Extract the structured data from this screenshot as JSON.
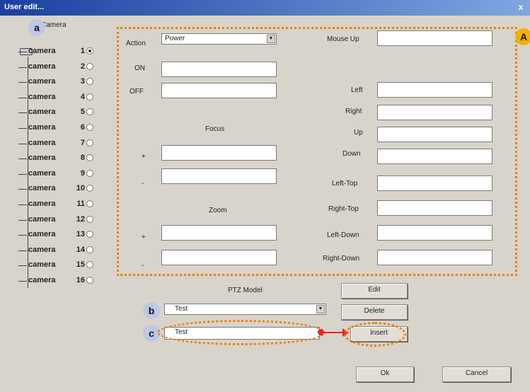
{
  "window": {
    "title": "User edit...",
    "close": "x"
  },
  "badges": {
    "a": "a",
    "A": "A",
    "b": "b",
    "c": "c"
  },
  "tree": {
    "label": "Camera",
    "items": [
      {
        "label": "camera",
        "num": "1",
        "selected": true
      },
      {
        "label": "camera",
        "num": "2"
      },
      {
        "label": "camera",
        "num": "3"
      },
      {
        "label": "camera",
        "num": "4"
      },
      {
        "label": "camera",
        "num": "5"
      },
      {
        "label": "camera",
        "num": "6"
      },
      {
        "label": "camera",
        "num": "7"
      },
      {
        "label": "camera",
        "num": "8"
      },
      {
        "label": "camera",
        "num": "9"
      },
      {
        "label": "camera",
        "num": "10"
      },
      {
        "label": "camera",
        "num": "11"
      },
      {
        "label": "camera",
        "num": "12"
      },
      {
        "label": "camera",
        "num": "13"
      },
      {
        "label": "camera",
        "num": "14"
      },
      {
        "label": "camera",
        "num": "15"
      },
      {
        "label": "camera",
        "num": "16"
      }
    ]
  },
  "form": {
    "action_label": "Action",
    "action_value": "Power",
    "on_label": "ON",
    "off_label": "OFF",
    "focus_label": "Focus",
    "plus": "+",
    "minus": "-",
    "zoom_label": "Zoom",
    "mouse_up_label": "Mouse Up",
    "left_label": "Left",
    "right_label": "Right",
    "up_label": "Up",
    "down_label": "Down",
    "left_top_label": "Left-Top",
    "right_top_label": "Right-Top",
    "left_down_label": "Left-Down",
    "right_down_label": "Right-Down"
  },
  "ptz": {
    "label": "PTZ Model",
    "model_value": "Test",
    "name_value": "Test",
    "edit": "Edit",
    "delete": "Delete",
    "insert": "Insert"
  },
  "footer": {
    "ok": "Ok",
    "cancel": "Cancel"
  }
}
